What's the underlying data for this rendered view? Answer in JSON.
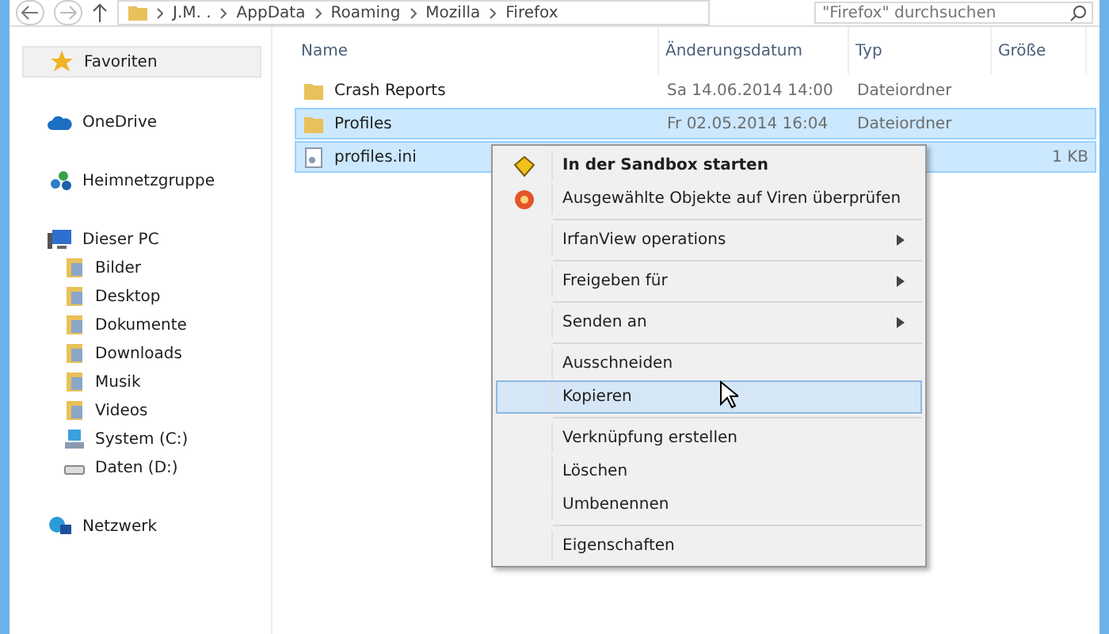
{
  "address_bar": {
    "path": [
      "J.M. .",
      "AppData",
      "Roaming",
      "Mozilla",
      "Firefox"
    ]
  },
  "search": {
    "placeholder": "\"Firefox\" durchsuchen"
  },
  "sidebar": {
    "groups": [
      {
        "label": "Favoriten",
        "selected": true
      },
      {
        "label": "OneDrive",
        "selected": false
      },
      {
        "label": "Heimnetzgruppe",
        "selected": false
      },
      {
        "label": "Dieser PC",
        "selected": false,
        "children": [
          {
            "label": "Bilder",
            "kind": "folder"
          },
          {
            "label": "Desktop",
            "kind": "folder"
          },
          {
            "label": "Dokumente",
            "kind": "folder"
          },
          {
            "label": "Downloads",
            "kind": "folder"
          },
          {
            "label": "Musik",
            "kind": "folder"
          },
          {
            "label": "Videos",
            "kind": "folder"
          },
          {
            "label": "System (C:)",
            "kind": "drive"
          },
          {
            "label": "Daten (D:)",
            "kind": "disk"
          }
        ]
      },
      {
        "label": "Netzwerk",
        "selected": false
      }
    ]
  },
  "table": {
    "columns": [
      "Name",
      "Änderungsdatum",
      "Typ",
      "Größe"
    ],
    "rows": [
      {
        "name": "Crash Reports",
        "kind": "folder",
        "date": "Sa 14.06.2014 14:00",
        "type": "Dateiordner",
        "selected": false
      },
      {
        "name": "Profiles",
        "kind": "folder",
        "date": "Fr 02.05.2014 16:04",
        "type": "Dateiordner",
        "selected": true
      },
      {
        "name": "profiles.ini",
        "kind": "file",
        "size": "1 KB",
        "selected": true
      }
    ]
  },
  "context_menu": {
    "groups": [
      [
        {
          "label": "In der Sandbox starten",
          "bold": true,
          "kind": "sandbox",
          "submenu": false,
          "selected": false
        },
        {
          "label": "Ausgewählte Objekte auf Viren überprüfen",
          "bold": false,
          "kind": "antivirus",
          "submenu": false,
          "selected": false
        }
      ],
      [
        {
          "label": "IrfanView operations",
          "bold": false,
          "submenu": true,
          "selected": false
        }
      ],
      [
        {
          "label": "Freigeben für",
          "bold": false,
          "submenu": true,
          "selected": false
        }
      ],
      [
        {
          "label": "Senden an",
          "bold": false,
          "submenu": true,
          "selected": false
        }
      ],
      [
        {
          "label": "Ausschneiden",
          "bold": false,
          "submenu": false,
          "selected": false
        },
        {
          "label": "Kopieren",
          "bold": false,
          "submenu": false,
          "selected": true
        }
      ],
      [
        {
          "label": "Verknüpfung erstellen",
          "bold": false,
          "submenu": false,
          "selected": false
        },
        {
          "label": "Löschen",
          "bold": false,
          "submenu": false,
          "selected": false
        },
        {
          "label": "Umbenennen",
          "bold": false,
          "submenu": false,
          "selected": false
        }
      ],
      [
        {
          "label": "Eigenschaften",
          "bold": false,
          "submenu": false,
          "selected": false
        }
      ]
    ]
  }
}
